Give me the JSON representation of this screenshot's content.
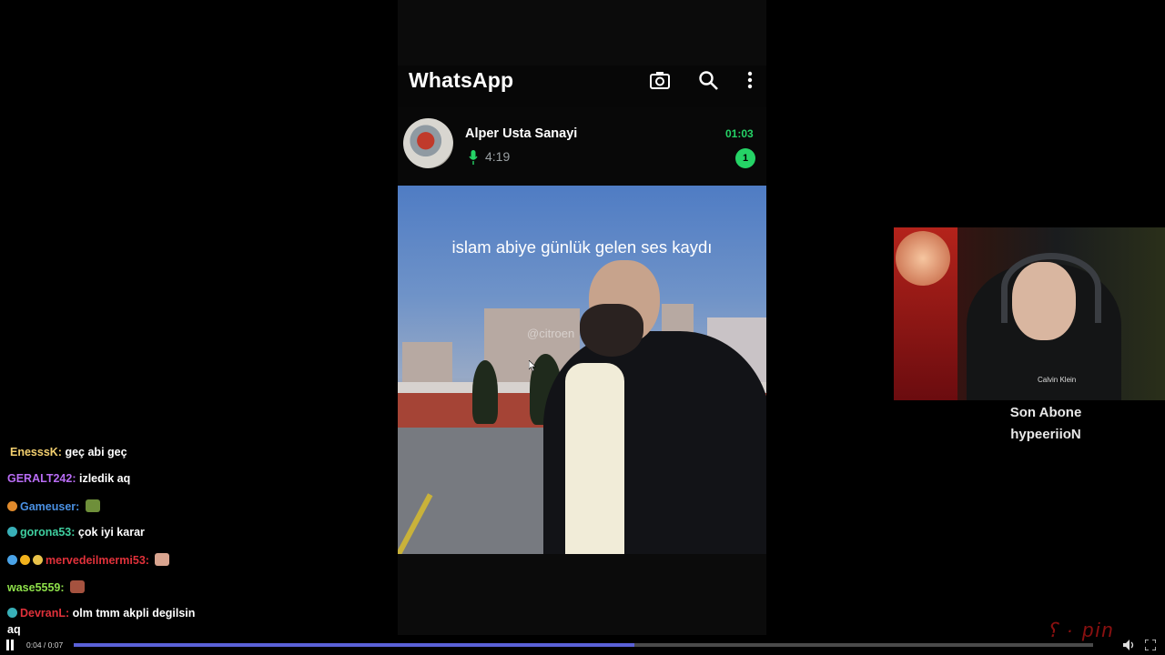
{
  "whatsapp": {
    "title": "WhatsApp",
    "icons": [
      "camera-icon",
      "search-icon",
      "more-vertical-icon"
    ],
    "contact_name": "Alper Usta Sanayi",
    "voice_duration": "4:19",
    "time": "01:03",
    "unread_count": "1",
    "accent": "#25d366"
  },
  "video": {
    "caption": "islam abiye günlük gelen ses kaydı",
    "watermark": "@citroen"
  },
  "chat": {
    "messages": [
      {
        "user": "EnesssK:",
        "text": "geç abi geç",
        "color": "#f4d06f"
      },
      {
        "user": "GERALT242:",
        "text": "izledik aq",
        "color": "#b86cf4"
      },
      {
        "user": "Gameuser:",
        "text": "",
        "color": "#4a90e2"
      },
      {
        "user": "gorona53:",
        "text": "çok iyi karar",
        "color": "#3fcfa0"
      },
      {
        "user": "mervedeilmermi53:",
        "text": "",
        "color": "#e0313a"
      },
      {
        "user": "wase5559:",
        "text": "",
        "color": "#8ee04a"
      },
      {
        "user": "DevranL:",
        "text": "olm tmm akpli degilsin",
        "color": "#e0313a",
        "continuation": "aq"
      }
    ]
  },
  "subscriber": {
    "label": "Son Abone",
    "name": "hypeeriioN"
  },
  "webcam": {
    "shirt_logo": "Calvin Klein"
  },
  "player": {
    "time": "0:04 / 0:07",
    "progress_fraction": 0.55,
    "fill_color": "#5a61d8"
  }
}
